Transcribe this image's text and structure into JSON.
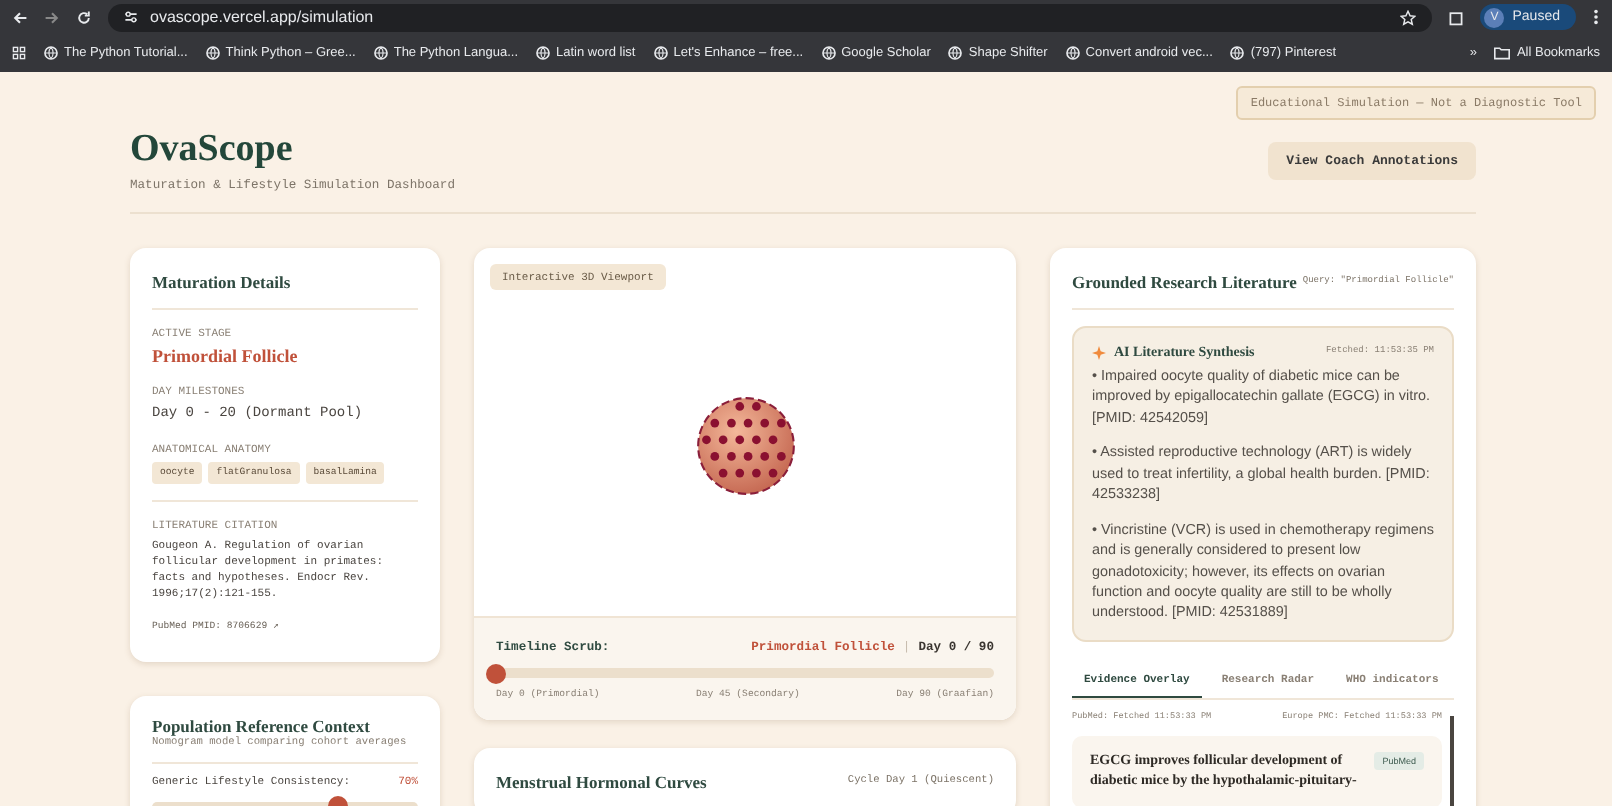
{
  "browser": {
    "url": "ovascope.vercel.app/simulation",
    "profile_initial": "V",
    "profile_status": "Paused",
    "bookmarks": [
      "The Python Tutorial...",
      "Think Python – Gree...",
      "The Python Langua...",
      "Latin word list",
      "Let's Enhance – free...",
      "Google Scholar",
      "Shape Shifter",
      "Convert android vec...",
      "(797) Pinterest"
    ],
    "overflow": "»",
    "all_bookmarks": "All Bookmarks"
  },
  "disclaimer": "Educational Simulation — Not a Diagnostic Tool",
  "header": {
    "title": "OvaScope",
    "subtitle": "Maturation & Lifestyle Simulation Dashboard",
    "button": "View Coach Annotations"
  },
  "maturation": {
    "title": "Maturation Details",
    "stage_label": "ACTIVE STAGE",
    "stage": "Primordial Follicle",
    "milestones_label": "DAY MILESTONES",
    "milestones": "Day 0 - 20 (Dormant Pool)",
    "anatomy_label": "ANATOMICAL ANATOMY",
    "tags": [
      "oocyte",
      "flatGranulosa",
      "basalLamina"
    ],
    "citation_label": "LITERATURE CITATION",
    "citation": "Gougeon A. Regulation of ovarian follicular development in primates: facts and hypotheses. Endocr Rev. 1996;17(2):121-155.",
    "pubmed_link": "PubMed PMID: 8706629 ↗"
  },
  "population": {
    "title": "Population Reference Context",
    "subtitle": "Nomogram model comparing cohort averages",
    "sliders": [
      {
        "label": "Generic Lifestyle Consistency:",
        "reading": "70%",
        "level": 0.7
      }
    ]
  },
  "viewport": {
    "badge": "Interactive 3D Viewport",
    "timeline_label": "Timeline Scrub:",
    "stage": "Primordial Follicle",
    "separator": "|",
    "day": "Day 0 / 90",
    "level": 0,
    "ticks": [
      "Day 0 (Primordial)",
      "Day 45 (Secondary)",
      "Day 90 (Graafian)"
    ]
  },
  "hormones": {
    "title": "Menstrual Hormonal Curves",
    "cycle_day": "Cycle Day 1 (Quiescent)"
  },
  "literature": {
    "title": "Grounded Research Literature",
    "query": "Query: \"Primordial Follicle\"",
    "synthesis": {
      "title": "AI Literature Synthesis",
      "fetched": "Fetched: 11:53:35 PM",
      "points": [
        "• Impaired oocyte quality of diabetic mice can be improved by epigallocatechin gallate (EGCG) in vitro. [PMID: 42542059]",
        "• Assisted reproductive technology (ART) is widely used to treat infertility, a global health burden. [PMID: 42533238]",
        "• Vincristine (VCR) is used in chemotherapy regimens and is generally considered to present low gonadotoxicity; however, its effects on ovarian function and oocyte quality are still to be wholly understood. [PMID: 42531889]"
      ]
    },
    "tabs": [
      {
        "label": "Evidence Overlay",
        "selected": true
      },
      {
        "label": "Research Radar",
        "selected": false
      },
      {
        "label": "WHO indicators",
        "selected": false
      }
    ],
    "sources": [
      "PubMed: Fetched 11:53:33 PM",
      "Europe PMC: Fetched 11:53:33 PM"
    ],
    "articles": [
      {
        "title": "EGCG improves follicular development of diabetic mice by the hypothalamic-pituitary-",
        "source": "PubMed"
      }
    ]
  }
}
